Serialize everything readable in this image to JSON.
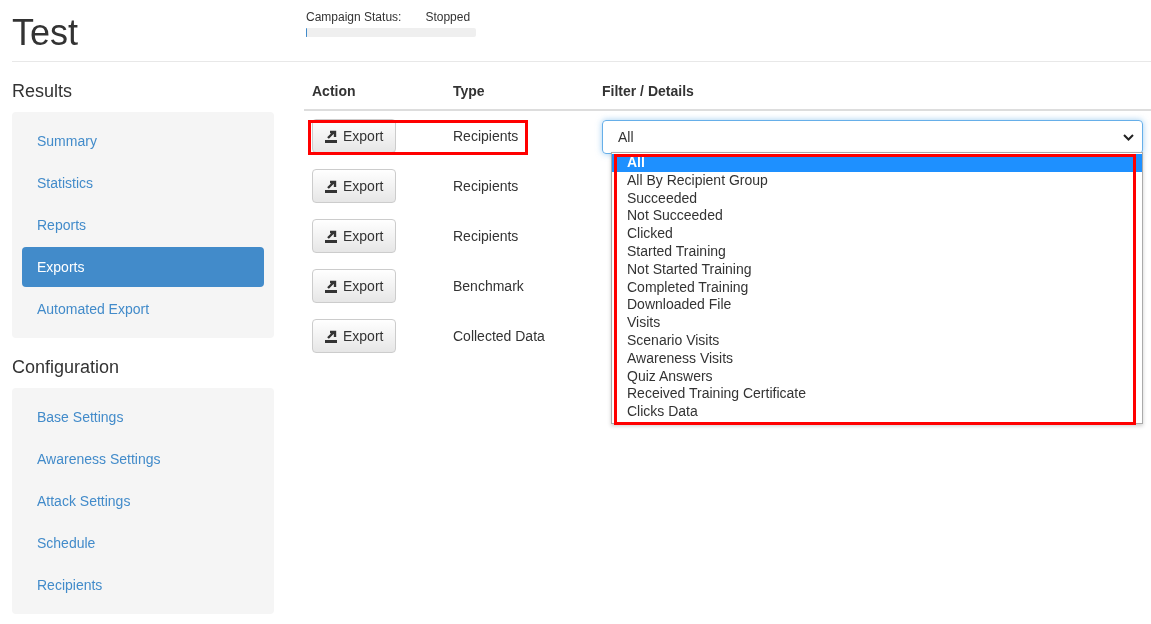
{
  "title": "Test",
  "campaign_status": {
    "label": "Campaign Status:",
    "value": "Stopped",
    "level": 0
  },
  "sidebar": [
    {
      "heading": "Results",
      "items": [
        {
          "label": "Summary",
          "selected": false
        },
        {
          "label": "Statistics",
          "selected": false
        },
        {
          "label": "Reports",
          "selected": false
        },
        {
          "label": "Exports",
          "selected": true
        },
        {
          "label": "Automated Export",
          "selected": false
        }
      ]
    },
    {
      "heading": "Configuration",
      "items": [
        {
          "label": "Base Settings",
          "selected": false
        },
        {
          "label": "Awareness Settings",
          "selected": false
        },
        {
          "label": "Attack Settings",
          "selected": false
        },
        {
          "label": "Schedule",
          "selected": false
        },
        {
          "label": "Recipients",
          "selected": false
        }
      ]
    }
  ],
  "table": {
    "columns": [
      "Action",
      "Type",
      "Filter / Details"
    ],
    "rows": [
      {
        "action": "Export",
        "type": "Recipients",
        "annotated": true
      },
      {
        "action": "Export",
        "type": "Recipients",
        "annotated": false
      },
      {
        "action": "Export",
        "type": "Recipients",
        "annotated": false
      },
      {
        "action": "Export",
        "type": "Benchmark",
        "annotated": false
      },
      {
        "action": "Export",
        "type": "Collected Data",
        "annotated": false
      }
    ]
  },
  "filter": {
    "value": "All",
    "annotated": true,
    "options": [
      {
        "label": "All",
        "selected": true
      },
      {
        "label": "All By Recipient Group",
        "selected": false
      },
      {
        "label": "Succeeded",
        "selected": false
      },
      {
        "label": "Not Succeeded",
        "selected": false
      },
      {
        "label": "Clicked",
        "selected": false
      },
      {
        "label": "Started Training",
        "selected": false
      },
      {
        "label": "Not Started Training",
        "selected": false
      },
      {
        "label": "Completed Training",
        "selected": false
      },
      {
        "label": "Downloaded File",
        "selected": false
      },
      {
        "label": "Visits",
        "selected": false
      },
      {
        "label": "Scenario Visits",
        "selected": false
      },
      {
        "label": "Awareness Visits",
        "selected": false
      },
      {
        "label": "Quiz Answers",
        "selected": false
      },
      {
        "label": "Received Training Certificate",
        "selected": false
      },
      {
        "label": "Clicks Data",
        "selected": false
      }
    ]
  }
}
